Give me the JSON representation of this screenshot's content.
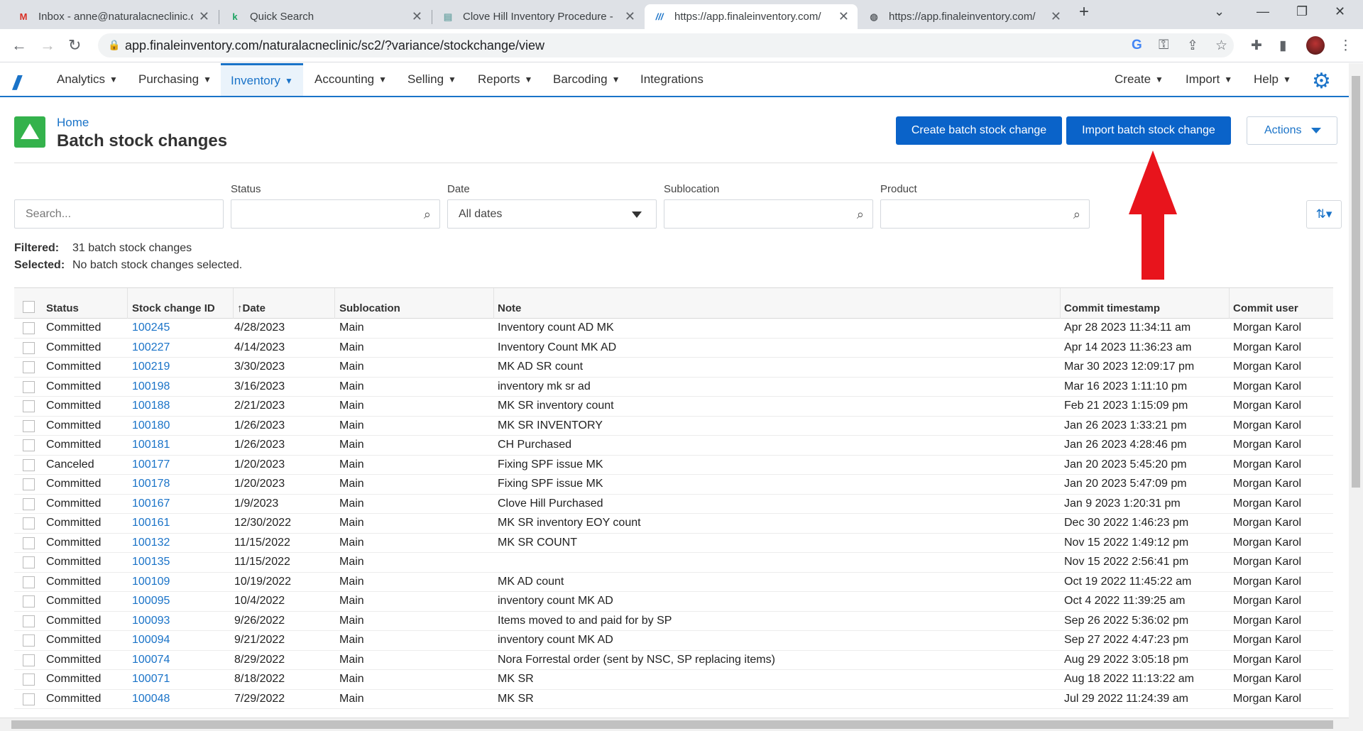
{
  "browser": {
    "tabs": [
      {
        "title": "Inbox - anne@naturalacneclinic.c",
        "icon": "gmail-icon"
      },
      {
        "title": "Quick Search",
        "icon": "k-icon"
      },
      {
        "title": "Clove Hill Inventory Procedure - ",
        "icon": "doc-icon"
      },
      {
        "title": "https://app.finaleinventory.com/",
        "icon": "finale-icon"
      },
      {
        "title": "https://app.finaleinventory.com/",
        "icon": "globe-icon"
      }
    ],
    "url": "app.finaleinventory.com/naturalacneclinic/sc2/?variance/stockchange/view"
  },
  "nav": {
    "items": [
      "Analytics",
      "Purchasing",
      "Inventory",
      "Accounting",
      "Selling",
      "Reports",
      "Barcoding",
      "Integrations"
    ],
    "active": "Inventory",
    "right": [
      "Create",
      "Import",
      "Help"
    ]
  },
  "header": {
    "breadcrumb": "Home",
    "title": "Batch stock changes",
    "create_btn": "Create batch stock change",
    "import_btn": "Import batch stock change",
    "actions_btn": "Actions"
  },
  "filters": {
    "search_placeholder": "Search...",
    "status_label": "Status",
    "date_label": "Date",
    "date_value": "All dates",
    "sublocation_label": "Sublocation",
    "product_label": "Product"
  },
  "summary": {
    "filtered_label": "Filtered:",
    "filtered_value": "31 batch stock changes",
    "selected_label": "Selected:",
    "selected_value": "No batch stock changes selected."
  },
  "table": {
    "columns": [
      "Status",
      "Stock change ID",
      "Date",
      "Sublocation",
      "Note",
      "Commit timestamp",
      "Commit user"
    ],
    "rows": [
      [
        "Committed",
        "100245",
        "4/28/2023",
        "Main",
        "Inventory count AD MK",
        "Apr 28 2023 11:34:11 am",
        "Morgan Karol"
      ],
      [
        "Committed",
        "100227",
        "4/14/2023",
        "Main",
        "Inventory Count MK AD",
        "Apr 14 2023 11:36:23 am",
        "Morgan Karol"
      ],
      [
        "Committed",
        "100219",
        "3/30/2023",
        "Main",
        "MK AD SR count",
        "Mar 30 2023 12:09:17 pm",
        "Morgan Karol"
      ],
      [
        "Committed",
        "100198",
        "3/16/2023",
        "Main",
        "inventory mk sr ad",
        "Mar 16 2023 1:11:10 pm",
        "Morgan Karol"
      ],
      [
        "Committed",
        "100188",
        "2/21/2023",
        "Main",
        "MK SR inventory count",
        "Feb 21 2023 1:15:09 pm",
        "Morgan Karol"
      ],
      [
        "Committed",
        "100180",
        "1/26/2023",
        "Main",
        "MK SR INVENTORY",
        "Jan 26 2023 1:33:21 pm",
        "Morgan Karol"
      ],
      [
        "Committed",
        "100181",
        "1/26/2023",
        "Main",
        "CH Purchased",
        "Jan 26 2023 4:28:46 pm",
        "Morgan Karol"
      ],
      [
        "Canceled",
        "100177",
        "1/20/2023",
        "Main",
        "Fixing SPF issue MK",
        "Jan 20 2023 5:45:20 pm",
        "Morgan Karol"
      ],
      [
        "Committed",
        "100178",
        "1/20/2023",
        "Main",
        "Fixing SPF issue MK",
        "Jan 20 2023 5:47:09 pm",
        "Morgan Karol"
      ],
      [
        "Committed",
        "100167",
        "1/9/2023",
        "Main",
        "Clove Hill Purchased",
        "Jan 9 2023 1:20:31 pm",
        "Morgan Karol"
      ],
      [
        "Committed",
        "100161",
        "12/30/2022",
        "Main",
        "MK SR inventory EOY count",
        "Dec 30 2022 1:46:23 pm",
        "Morgan Karol"
      ],
      [
        "Committed",
        "100132",
        "11/15/2022",
        "Main",
        "MK SR COUNT",
        "Nov 15 2022 1:49:12 pm",
        "Morgan Karol"
      ],
      [
        "Committed",
        "100135",
        "11/15/2022",
        "Main",
        "",
        "Nov 15 2022 2:56:41 pm",
        "Morgan Karol"
      ],
      [
        "Committed",
        "100109",
        "10/19/2022",
        "Main",
        "MK AD count",
        "Oct 19 2022 11:45:22 am",
        "Morgan Karol"
      ],
      [
        "Committed",
        "100095",
        "10/4/2022",
        "Main",
        "inventory count MK AD",
        "Oct 4 2022 11:39:25 am",
        "Morgan Karol"
      ],
      [
        "Committed",
        "100093",
        "9/26/2022",
        "Main",
        "Items moved to and paid for by SP",
        "Sep 26 2022 5:36:02 pm",
        "Morgan Karol"
      ],
      [
        "Committed",
        "100094",
        "9/21/2022",
        "Main",
        "inventory count MK AD",
        "Sep 27 2022 4:47:23 pm",
        "Morgan Karol"
      ],
      [
        "Committed",
        "100074",
        "8/29/2022",
        "Main",
        "Nora Forrestal order (sent by NSC, SP replacing items)",
        "Aug 29 2022 3:05:18 pm",
        "Morgan Karol"
      ],
      [
        "Committed",
        "100071",
        "8/18/2022",
        "Main",
        "MK SR",
        "Aug 18 2022 11:13:22 am",
        "Morgan Karol"
      ],
      [
        "Committed",
        "100048",
        "7/29/2022",
        "Main",
        "MK SR",
        "Jul 29 2022 11:24:39 am",
        "Morgan Karol"
      ]
    ]
  },
  "colors": {
    "accent": "#1a73c8",
    "button": "#0a63c9",
    "annotation_arrow": "#e8141c"
  }
}
